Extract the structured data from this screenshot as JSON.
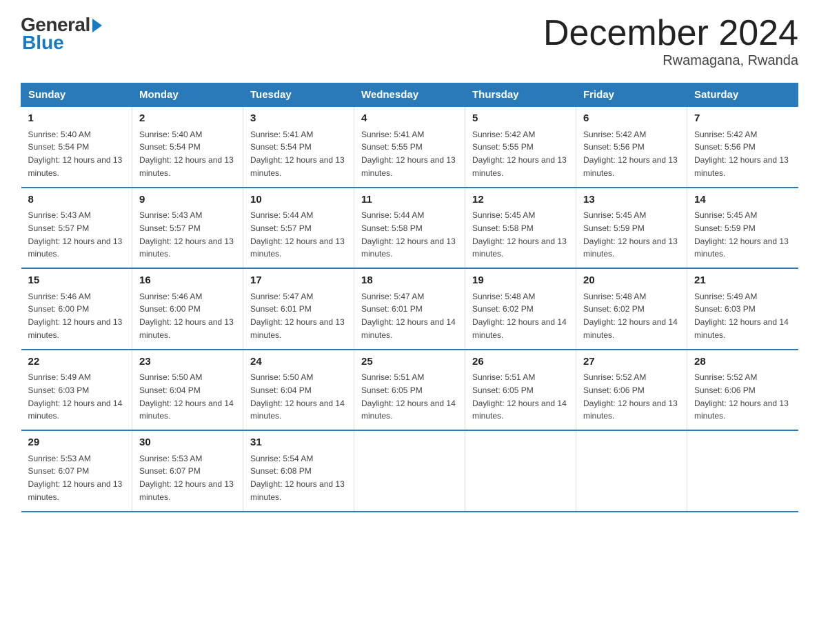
{
  "logo": {
    "general": "General",
    "blue": "Blue",
    "tagline": "Blue"
  },
  "header": {
    "title": "December 2024",
    "location": "Rwamagana, Rwanda"
  },
  "columns": [
    "Sunday",
    "Monday",
    "Tuesday",
    "Wednesday",
    "Thursday",
    "Friday",
    "Saturday"
  ],
  "weeks": [
    [
      {
        "day": "1",
        "sunrise": "5:40 AM",
        "sunset": "5:54 PM",
        "daylight": "12 hours and 13 minutes."
      },
      {
        "day": "2",
        "sunrise": "5:40 AM",
        "sunset": "5:54 PM",
        "daylight": "12 hours and 13 minutes."
      },
      {
        "day": "3",
        "sunrise": "5:41 AM",
        "sunset": "5:54 PM",
        "daylight": "12 hours and 13 minutes."
      },
      {
        "day": "4",
        "sunrise": "5:41 AM",
        "sunset": "5:55 PM",
        "daylight": "12 hours and 13 minutes."
      },
      {
        "day": "5",
        "sunrise": "5:42 AM",
        "sunset": "5:55 PM",
        "daylight": "12 hours and 13 minutes."
      },
      {
        "day": "6",
        "sunrise": "5:42 AM",
        "sunset": "5:56 PM",
        "daylight": "12 hours and 13 minutes."
      },
      {
        "day": "7",
        "sunrise": "5:42 AM",
        "sunset": "5:56 PM",
        "daylight": "12 hours and 13 minutes."
      }
    ],
    [
      {
        "day": "8",
        "sunrise": "5:43 AM",
        "sunset": "5:57 PM",
        "daylight": "12 hours and 13 minutes."
      },
      {
        "day": "9",
        "sunrise": "5:43 AM",
        "sunset": "5:57 PM",
        "daylight": "12 hours and 13 minutes."
      },
      {
        "day": "10",
        "sunrise": "5:44 AM",
        "sunset": "5:57 PM",
        "daylight": "12 hours and 13 minutes."
      },
      {
        "day": "11",
        "sunrise": "5:44 AM",
        "sunset": "5:58 PM",
        "daylight": "12 hours and 13 minutes."
      },
      {
        "day": "12",
        "sunrise": "5:45 AM",
        "sunset": "5:58 PM",
        "daylight": "12 hours and 13 minutes."
      },
      {
        "day": "13",
        "sunrise": "5:45 AM",
        "sunset": "5:59 PM",
        "daylight": "12 hours and 13 minutes."
      },
      {
        "day": "14",
        "sunrise": "5:45 AM",
        "sunset": "5:59 PM",
        "daylight": "12 hours and 13 minutes."
      }
    ],
    [
      {
        "day": "15",
        "sunrise": "5:46 AM",
        "sunset": "6:00 PM",
        "daylight": "12 hours and 13 minutes."
      },
      {
        "day": "16",
        "sunrise": "5:46 AM",
        "sunset": "6:00 PM",
        "daylight": "12 hours and 13 minutes."
      },
      {
        "day": "17",
        "sunrise": "5:47 AM",
        "sunset": "6:01 PM",
        "daylight": "12 hours and 13 minutes."
      },
      {
        "day": "18",
        "sunrise": "5:47 AM",
        "sunset": "6:01 PM",
        "daylight": "12 hours and 14 minutes."
      },
      {
        "day": "19",
        "sunrise": "5:48 AM",
        "sunset": "6:02 PM",
        "daylight": "12 hours and 14 minutes."
      },
      {
        "day": "20",
        "sunrise": "5:48 AM",
        "sunset": "6:02 PM",
        "daylight": "12 hours and 14 minutes."
      },
      {
        "day": "21",
        "sunrise": "5:49 AM",
        "sunset": "6:03 PM",
        "daylight": "12 hours and 14 minutes."
      }
    ],
    [
      {
        "day": "22",
        "sunrise": "5:49 AM",
        "sunset": "6:03 PM",
        "daylight": "12 hours and 14 minutes."
      },
      {
        "day": "23",
        "sunrise": "5:50 AM",
        "sunset": "6:04 PM",
        "daylight": "12 hours and 14 minutes."
      },
      {
        "day": "24",
        "sunrise": "5:50 AM",
        "sunset": "6:04 PM",
        "daylight": "12 hours and 14 minutes."
      },
      {
        "day": "25",
        "sunrise": "5:51 AM",
        "sunset": "6:05 PM",
        "daylight": "12 hours and 14 minutes."
      },
      {
        "day": "26",
        "sunrise": "5:51 AM",
        "sunset": "6:05 PM",
        "daylight": "12 hours and 14 minutes."
      },
      {
        "day": "27",
        "sunrise": "5:52 AM",
        "sunset": "6:06 PM",
        "daylight": "12 hours and 13 minutes."
      },
      {
        "day": "28",
        "sunrise": "5:52 AM",
        "sunset": "6:06 PM",
        "daylight": "12 hours and 13 minutes."
      }
    ],
    [
      {
        "day": "29",
        "sunrise": "5:53 AM",
        "sunset": "6:07 PM",
        "daylight": "12 hours and 13 minutes."
      },
      {
        "day": "30",
        "sunrise": "5:53 AM",
        "sunset": "6:07 PM",
        "daylight": "12 hours and 13 minutes."
      },
      {
        "day": "31",
        "sunrise": "5:54 AM",
        "sunset": "6:08 PM",
        "daylight": "12 hours and 13 minutes."
      },
      null,
      null,
      null,
      null
    ]
  ]
}
